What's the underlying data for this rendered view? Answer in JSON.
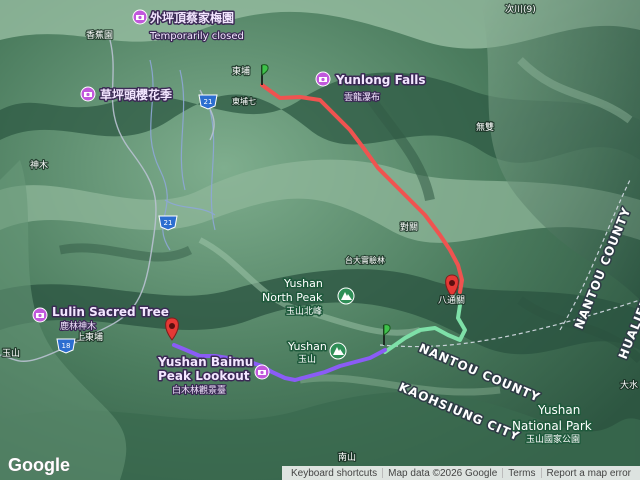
{
  "map": {
    "type": "terrain",
    "colors": {
      "terrain_dark": "#2f5a43",
      "terrain_mid": "#4c7d5f",
      "terrain_light": "#8fb79a",
      "route_red": "#ef5350",
      "route_green": "#7ee0a8",
      "route_purple": "#8a5cf6",
      "poi_purple": "#c158dc",
      "marker_red": "#e53935",
      "marker_green": "#3ec24a"
    }
  },
  "labels": {
    "closed_place": "外坪頂蔡家梅園",
    "closed_status": "Temporarily closed",
    "xiangping": "香蕉園",
    "dongpu": "東埔",
    "dongpu_small": "東埔七",
    "blossom": "草坪頭櫻花季",
    "shenmu": "神木",
    "yunlong_en": "Yunlong Falls",
    "yunlong_zh": "雲龍瀑布",
    "wushuang": "無雙",
    "duigao": "對關",
    "road_cih": "次川(9)",
    "bridge": "台大實驗林",
    "bamen": "八通關",
    "yushan_north_en": "Yushan",
    "yushan_north_en2": "North Peak",
    "yushan_north_zh": "玉山北峰",
    "yushan_en": "Yushan",
    "yushan_zh": "玉山",
    "lulin_en": "Lulin Sacred Tree",
    "lulin_zh": "鹿林神木",
    "shangdongpu": "上東埔",
    "yushan_left": "玉山",
    "lookout_en": "Yushan Baimu",
    "lookout_en2": "Peak Lookout",
    "lookout_zh": "白木林觀景臺",
    "nantou_vertical": "NANTOU COUNTY",
    "hualien_vertical": "HUALIEN",
    "nantou_diag": "NANTOU COUNTY",
    "kaohsiung": "KAOHSIUNG CITY",
    "park_en": "Yushan",
    "park_en2": "National Park",
    "park_zh": "玉山國家公園",
    "dashui": "大水",
    "nanshan": "南山",
    "road_21a": "21",
    "road_21b": "21",
    "road_18": "18"
  },
  "footer": {
    "logo": "Google",
    "shortcuts": "Keyboard shortcuts",
    "mapdata": "Map data ©2026 Google",
    "terms": "Terms",
    "report": "Report a map error"
  }
}
